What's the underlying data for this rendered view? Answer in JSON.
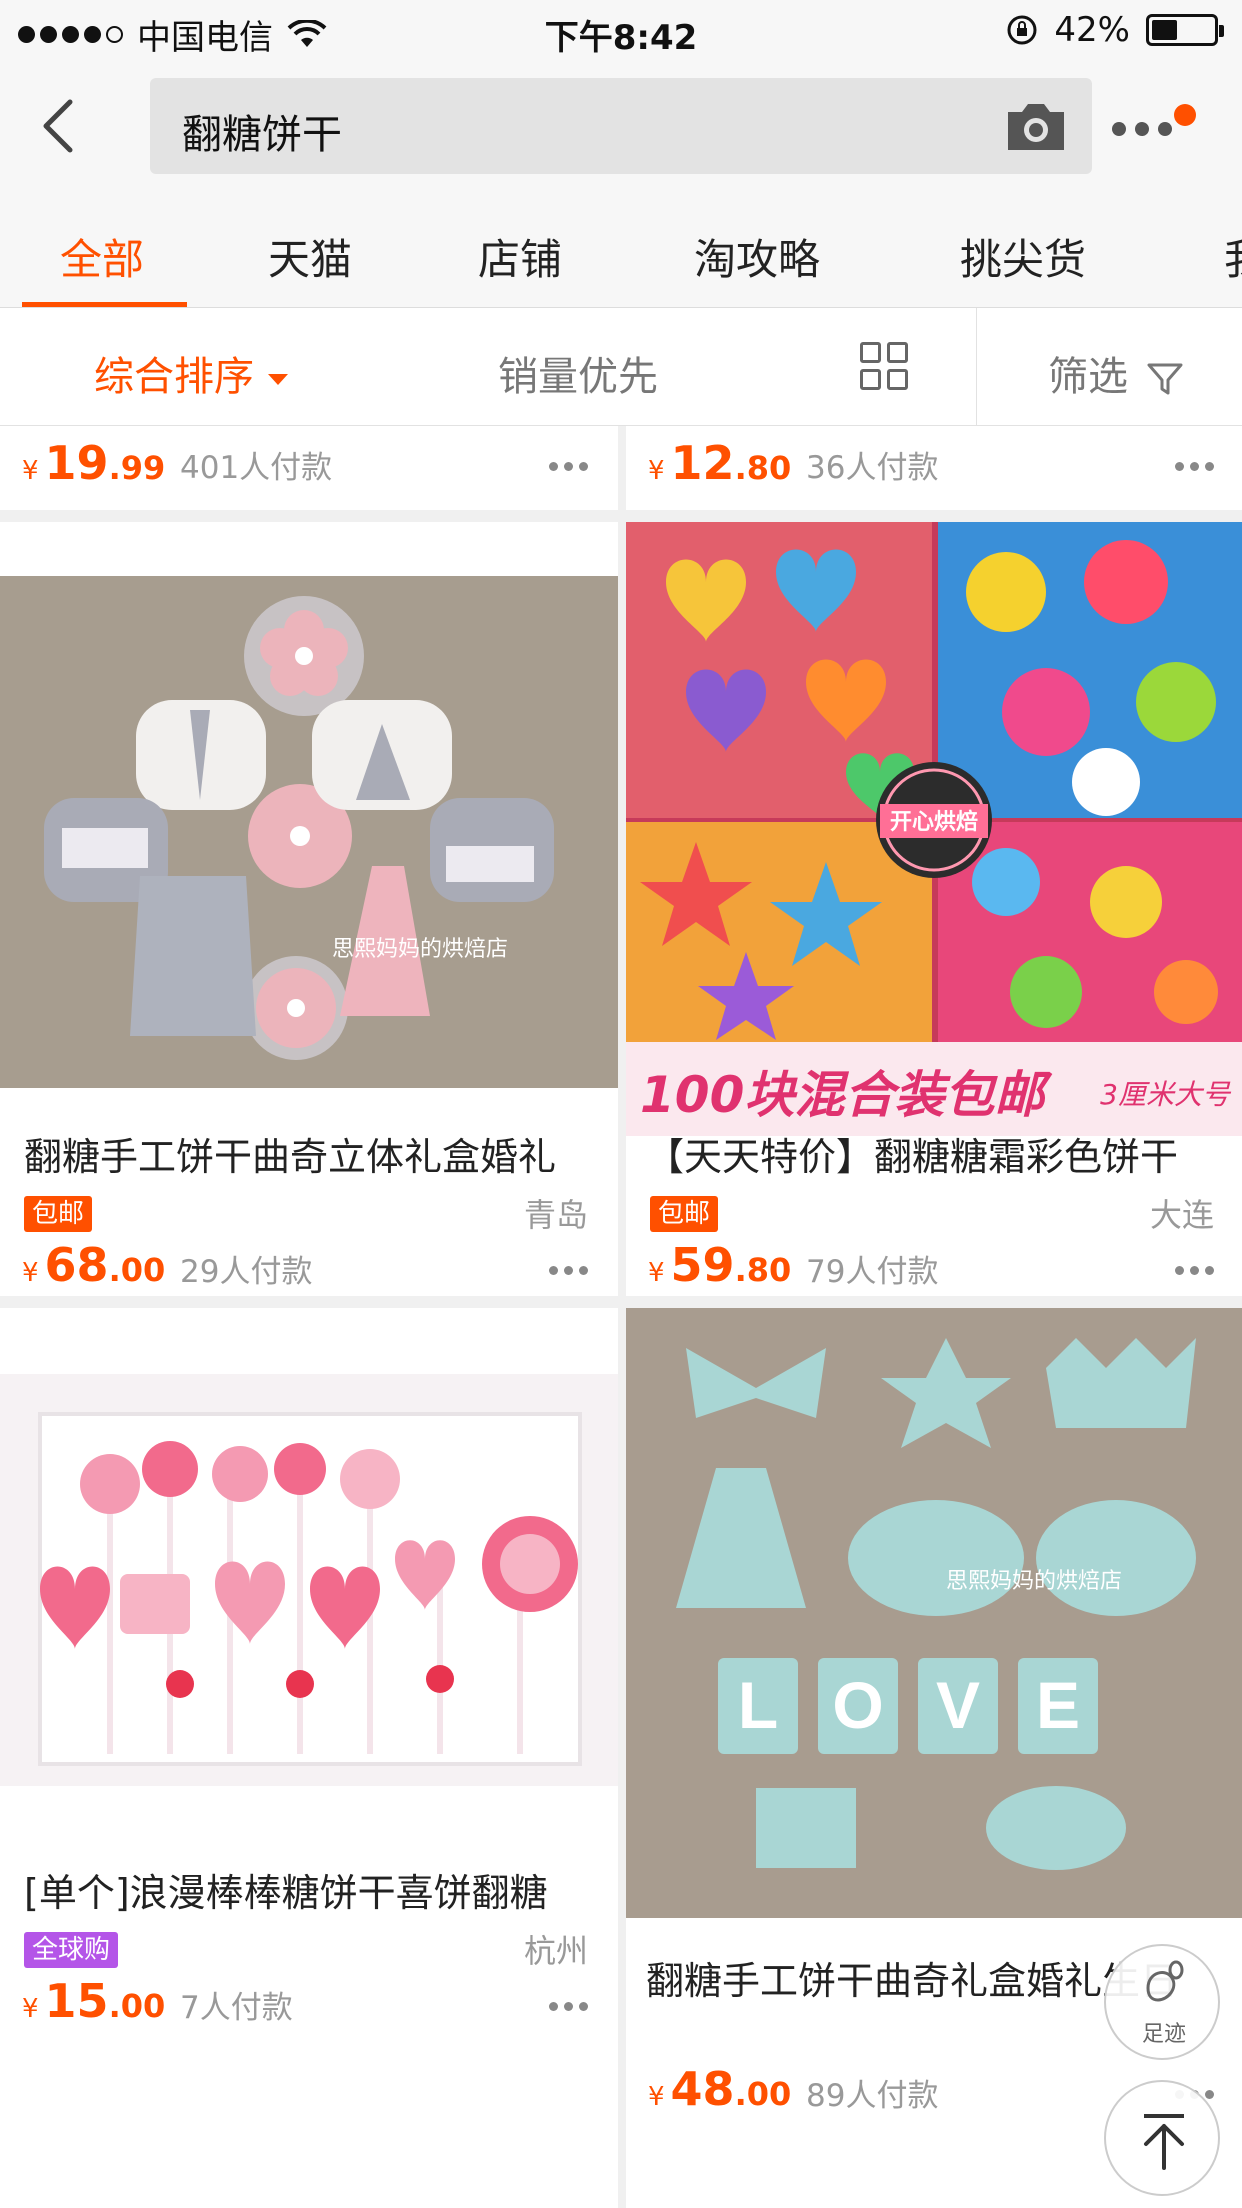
{
  "status": {
    "carrier": "中国电信",
    "time": "下午8:42",
    "battery": "42%",
    "battery_level": 0.42
  },
  "search": {
    "query": "翻糖饼干"
  },
  "tabs": [
    {
      "label": "全部",
      "active": true
    },
    {
      "label": "天猫"
    },
    {
      "label": "店铺"
    },
    {
      "label": "淘攻略"
    },
    {
      "label": "挑尖货"
    },
    {
      "label": "我"
    }
  ],
  "sort": {
    "comprehensive": "综合排序",
    "sales": "销量优先",
    "filter": "筛选"
  },
  "colors": {
    "accent": "#ff5000",
    "global_tag": "#b455e8"
  },
  "top_row": [
    {
      "price_int": "19",
      "price_dec": ".99",
      "sold": "401人付款"
    },
    {
      "price_int": "12",
      "price_dec": ".80",
      "sold": "36人付款"
    }
  ],
  "products": [
    {
      "title": "翻糖手工饼干曲奇立体礼盒婚礼",
      "tag": "包邮",
      "location": "青岛",
      "price_int": "68",
      "price_dec": ".00",
      "sold": "29人付款",
      "image_watermark": "思熙妈妈的烘焙店"
    },
    {
      "title": "【天天特价】翻糖糖霜彩色饼干",
      "tag": "包邮",
      "location": "大连",
      "price_int": "59",
      "price_dec": ".80",
      "sold": "79人付款",
      "image_banner": "100块混合装包邮",
      "image_banner_sub": "3厘米大号",
      "image_badge": "开心烘焙"
    },
    {
      "title": "[单个]浪漫棒棒糖饼干喜饼翻糖",
      "tag": "全球购",
      "location": "杭州",
      "price_int": "15",
      "price_dec": ".00",
      "sold": "7人付款"
    },
    {
      "title": "翻糖手工饼干曲奇礼盒婚礼生日",
      "price_int": "48",
      "price_dec": ".00",
      "sold": "89人付款",
      "image_love": "LOVE",
      "image_watermark": "思熙妈妈的烘焙店"
    }
  ],
  "floating": {
    "footprint_label": "足迹"
  },
  "currency": "¥"
}
